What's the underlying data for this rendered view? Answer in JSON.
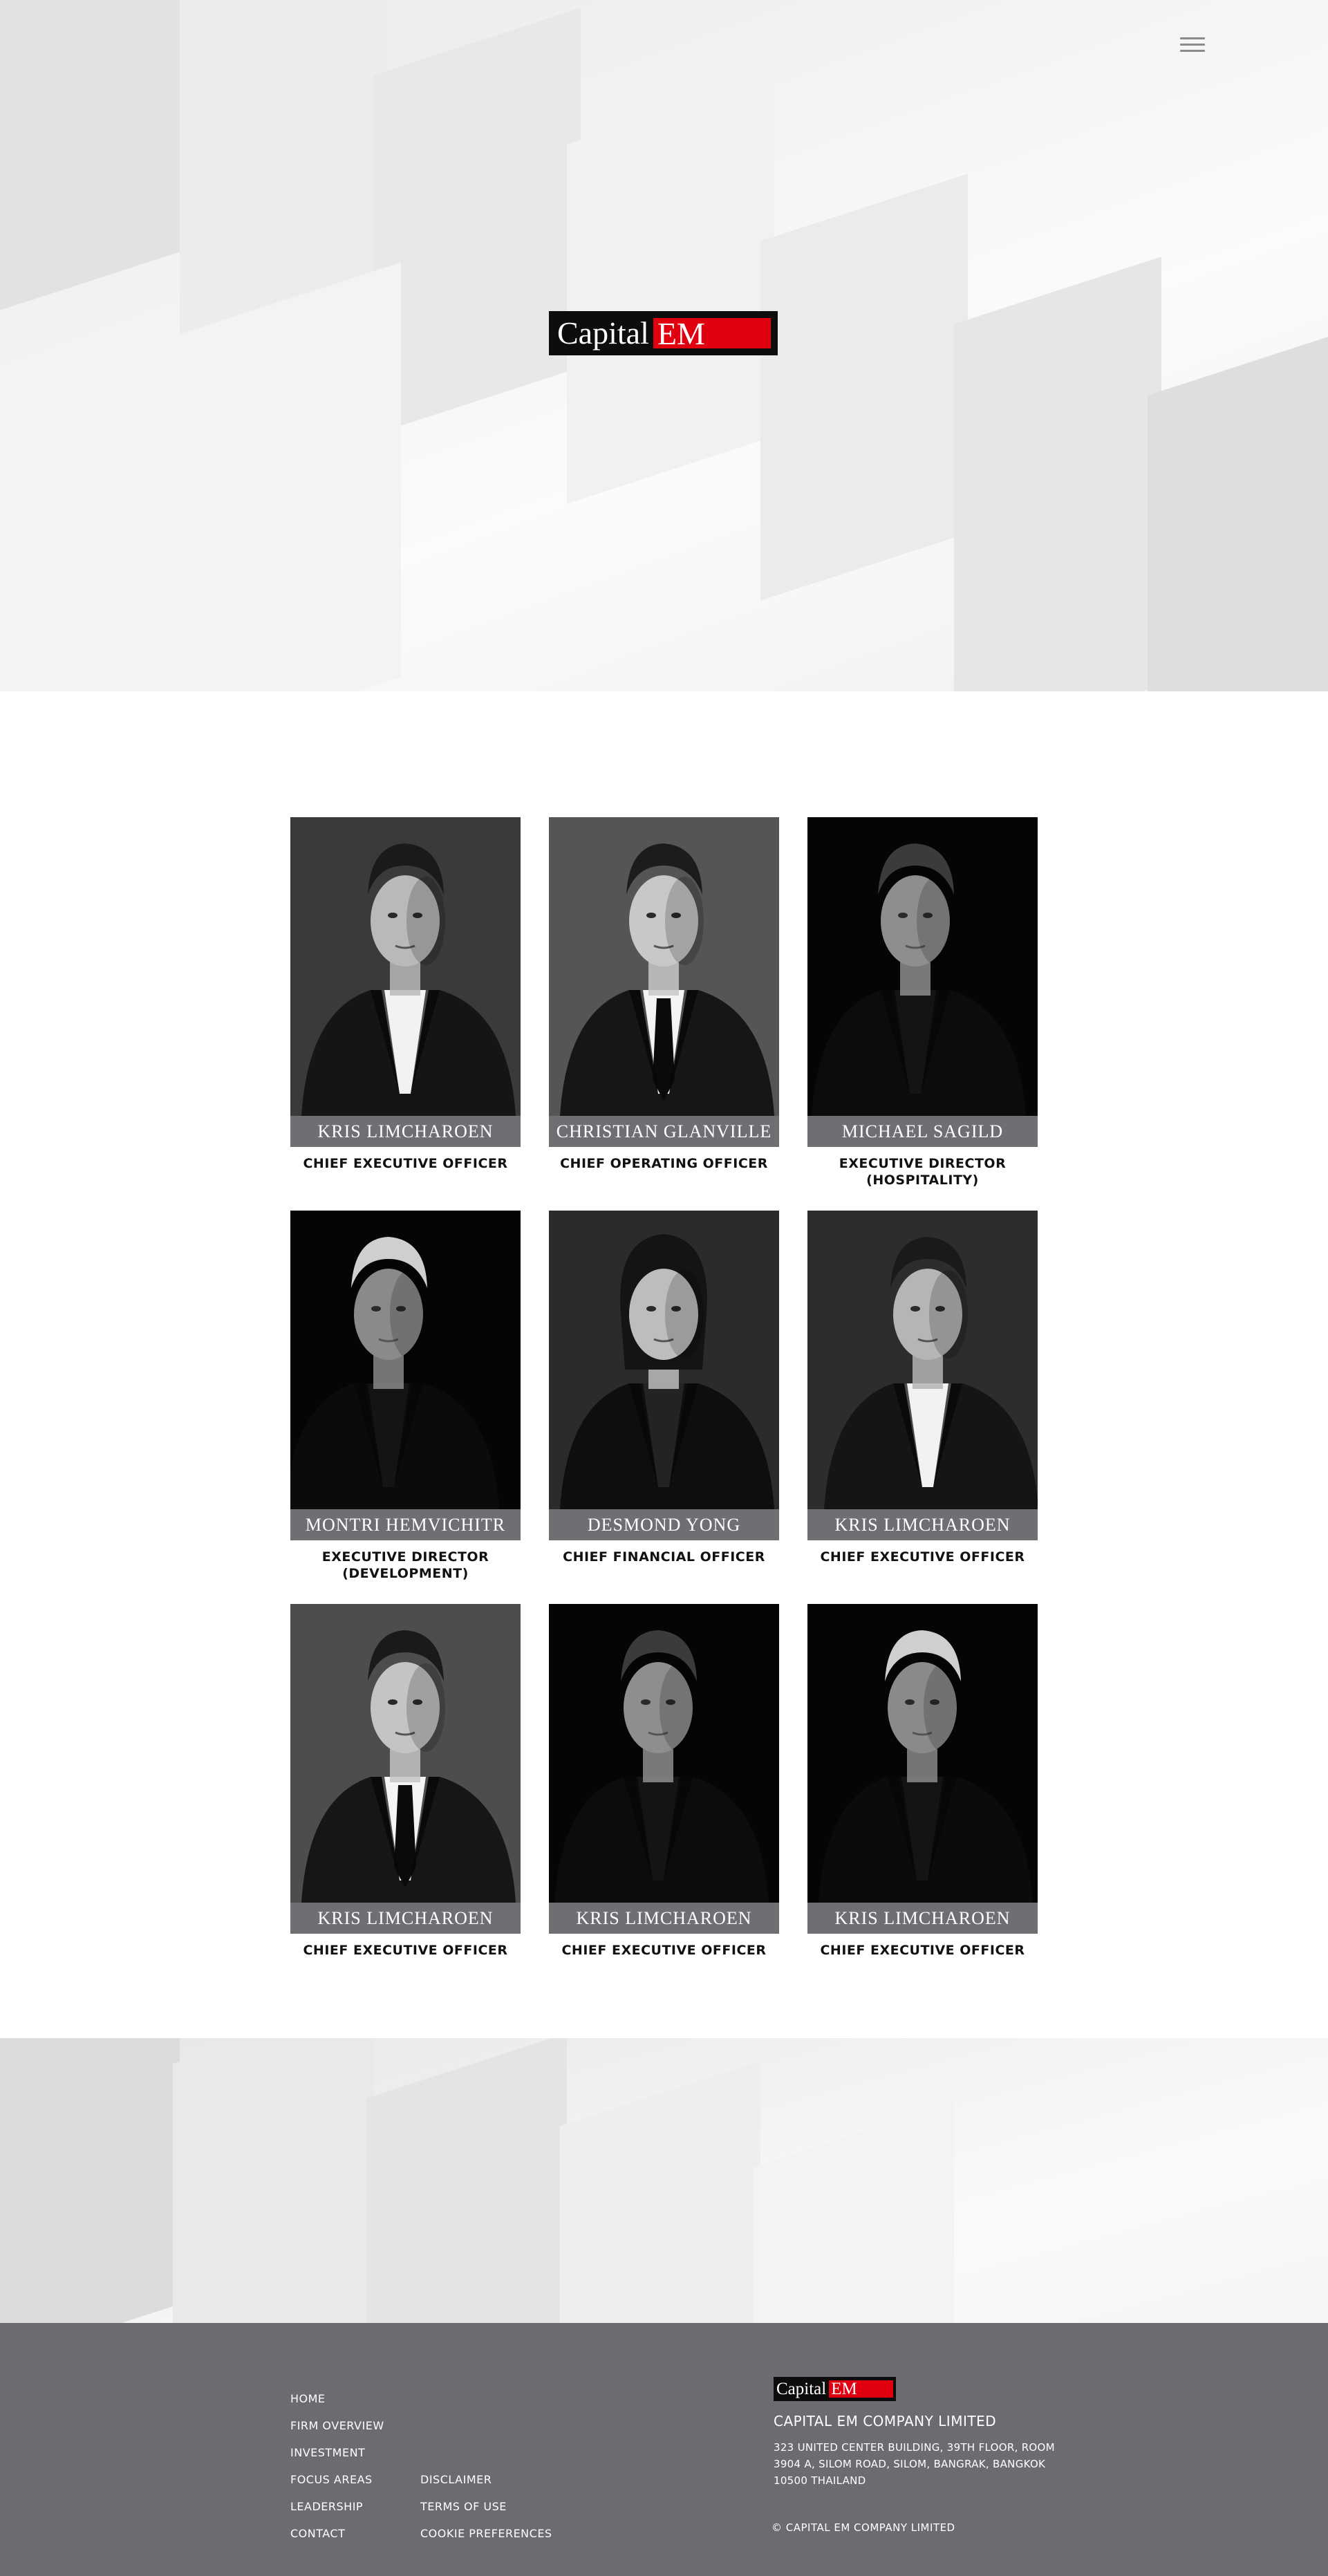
{
  "header": {
    "menu_icon": "hamburger-menu-icon",
    "logo": {
      "text": "Capital",
      "accent_text": "EM",
      "accent_color": "#e0000f"
    }
  },
  "team": [
    {
      "name": "KRIS LIMCHAROEN",
      "role": "CHIEF EXECUTIVE OFFICER"
    },
    {
      "name": "CHRISTIAN GLANVILLE",
      "role": "CHIEF OPERATING OFFICER"
    },
    {
      "name": "MICHAEL SAGILD",
      "role": "EXECUTIVE DIRECTOR (HOSPITALITY)"
    },
    {
      "name": "MONTRI HEMVICHITR",
      "role": "EXECUTIVE DIRECTOR (DEVELOPMENT)"
    },
    {
      "name": "DESMOND YONG",
      "role": "CHIEF FINANCIAL OFFICER"
    },
    {
      "name": "KRIS LIMCHAROEN",
      "role": "CHIEF EXECUTIVE OFFICER"
    },
    {
      "name": "KRIS LIMCHAROEN",
      "role": "CHIEF EXECUTIVE OFFICER"
    },
    {
      "name": "KRIS LIMCHAROEN",
      "role": "CHIEF EXECUTIVE OFFICER"
    },
    {
      "name": "KRIS LIMCHAROEN",
      "role": "CHIEF EXECUTIVE OFFICER"
    }
  ],
  "footer": {
    "nav": [
      "HOME",
      "FIRM OVERVIEW",
      "INVESTMENT",
      "FOCUS AREAS",
      "LEADERSHIP",
      "CONTACT"
    ],
    "legal": [
      "DISCLAIMER",
      "TERMS OF USE",
      "COOKIE PREFERENCES"
    ],
    "logo": {
      "text": "Capital",
      "accent_text": "EM"
    },
    "company_name": "CAPITAL EM COMPANY LIMITED",
    "address": "323 UNITED CENTER BUILDING, 39TH FLOOR, ROOM 3904 A, SILOM ROAD, SILOM, BANGRAK, BANGKOK 10500 THAILAND",
    "copyright": "© CAPITAL EM COMPANY LIMITED"
  },
  "colors": {
    "nameplate": "#6e6f73",
    "footer_bg": "#6b6c70",
    "brand_red": "#e0000f",
    "logo_bg": "#0d0d0d"
  }
}
